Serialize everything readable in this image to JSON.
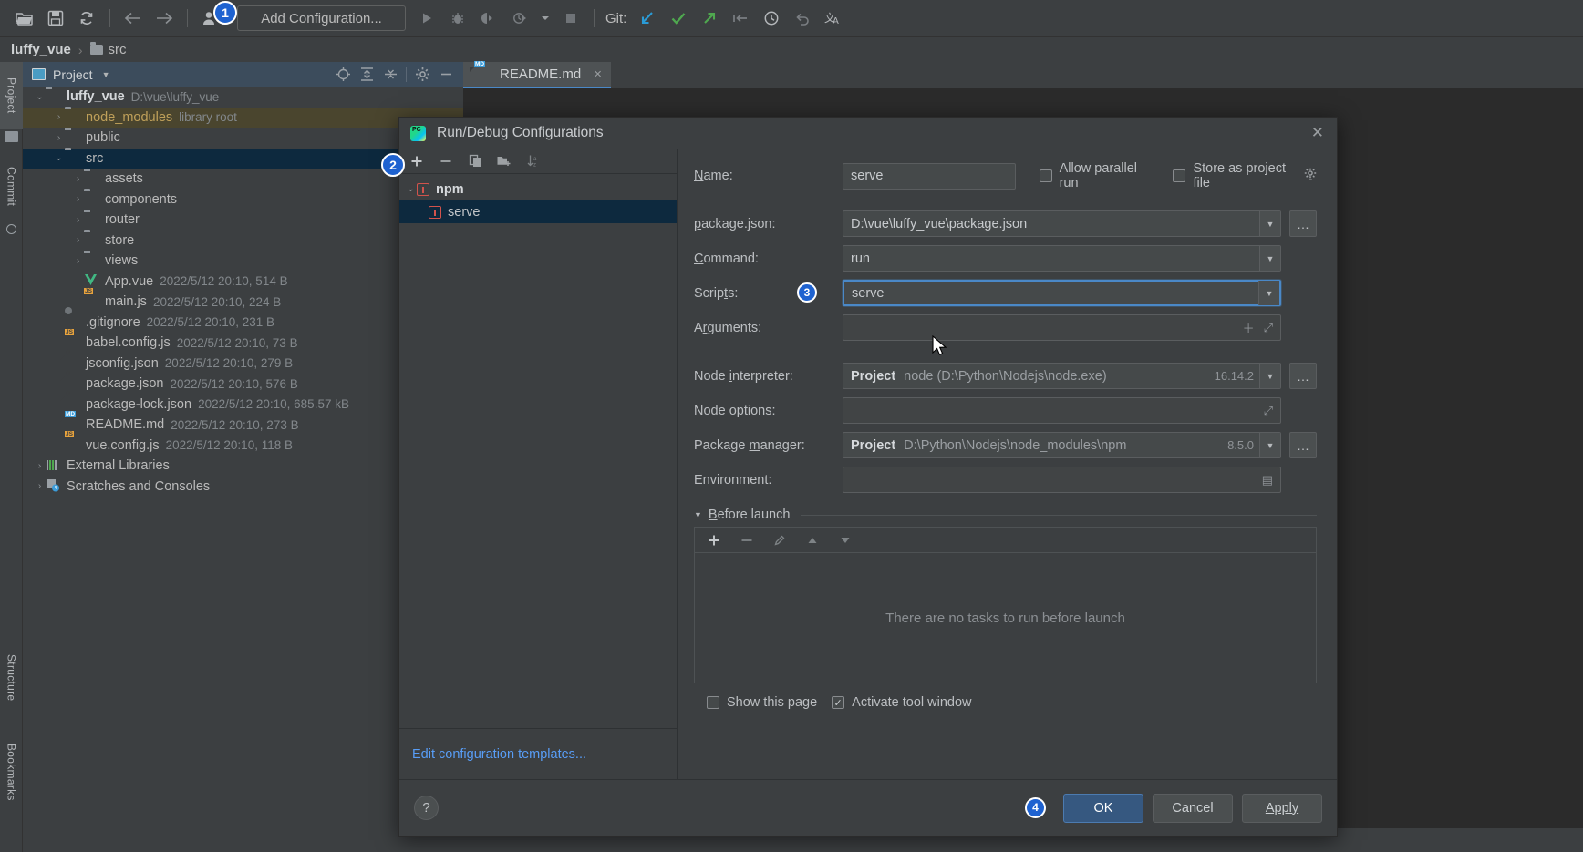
{
  "toolbar": {
    "icons": [
      "open-folder-icon",
      "save-icon",
      "sync-icon",
      "back-arrow-icon",
      "forward-arrow-icon",
      "user-profile-icon"
    ],
    "add_configuration_label": "Add Configuration...",
    "run_icons": [
      "run-icon",
      "debug-icon",
      "run-with-coverage-icon",
      "profile-icon",
      "dropdown-icon",
      "stop-icon"
    ],
    "git_label": "Git:",
    "git_icons": [
      "update-project-icon",
      "commit-icon",
      "push-icon",
      "rollback-arrow-icon",
      "history-clock-icon",
      "undo-icon",
      "translate-icon"
    ],
    "badge_1": "1"
  },
  "breadcrumb": {
    "root": "luffy_vue",
    "separator": "›",
    "current": "src"
  },
  "left_tool_bars": {
    "top": [
      {
        "label": "Project",
        "active": true
      },
      {
        "label": "Commit",
        "active": false
      }
    ],
    "bottom": [
      {
        "label": "Structure"
      },
      {
        "label": "Bookmarks"
      }
    ]
  },
  "project_panel": {
    "title": "Project",
    "toolbar_icons": [
      "locate-icon",
      "expand-all-icon",
      "collapse-all-icon",
      "gear-icon",
      "hide-icon"
    ],
    "badge_2": "2",
    "tree": [
      {
        "indent": 0,
        "arrow": "⌄",
        "icon": "folder",
        "name": "luffy_vue",
        "bold": true,
        "meta": "D:\\vue\\luffy_vue",
        "state": "normal"
      },
      {
        "indent": 1,
        "arrow": "›",
        "icon": "folder",
        "name": "node_modules",
        "bold": false,
        "meta": "library root",
        "state": "library"
      },
      {
        "indent": 1,
        "arrow": "›",
        "icon": "folder",
        "name": "public",
        "bold": false,
        "meta": "",
        "state": "normal"
      },
      {
        "indent": 1,
        "arrow": "⌄",
        "icon": "folder",
        "name": "src",
        "bold": false,
        "meta": "",
        "state": "selected"
      },
      {
        "indent": 2,
        "arrow": "›",
        "icon": "folder",
        "name": "assets",
        "bold": false,
        "meta": "",
        "state": "normal"
      },
      {
        "indent": 2,
        "arrow": "›",
        "icon": "folder",
        "name": "components",
        "bold": false,
        "meta": "",
        "state": "normal"
      },
      {
        "indent": 2,
        "arrow": "›",
        "icon": "folder",
        "name": "router",
        "bold": false,
        "meta": "",
        "state": "normal"
      },
      {
        "indent": 2,
        "arrow": "›",
        "icon": "folder",
        "name": "store",
        "bold": false,
        "meta": "",
        "state": "normal"
      },
      {
        "indent": 2,
        "arrow": "›",
        "icon": "folder",
        "name": "views",
        "bold": false,
        "meta": "",
        "state": "normal"
      },
      {
        "indent": 2,
        "arrow": "",
        "icon": "vue",
        "name": "App.vue",
        "bold": false,
        "meta": "2022/5/12 20:10, 514 B",
        "state": "normal"
      },
      {
        "indent": 2,
        "arrow": "",
        "icon": "js",
        "name": "main.js",
        "bold": false,
        "meta": "2022/5/12 20:10, 224 B",
        "state": "normal"
      },
      {
        "indent": 1,
        "arrow": "",
        "icon": "gitignore",
        "name": ".gitignore",
        "bold": false,
        "meta": "2022/5/12 20:10, 231 B",
        "state": "normal"
      },
      {
        "indent": 1,
        "arrow": "",
        "icon": "js",
        "name": "babel.config.js",
        "bold": false,
        "meta": "2022/5/12 20:10, 73 B",
        "state": "normal"
      },
      {
        "indent": 1,
        "arrow": "",
        "icon": "json",
        "name": "jsconfig.json",
        "bold": false,
        "meta": "2022/5/12 20:10, 279 B",
        "state": "normal"
      },
      {
        "indent": 1,
        "arrow": "",
        "icon": "json",
        "name": "package.json",
        "bold": false,
        "meta": "2022/5/12 20:10, 576 B",
        "state": "normal"
      },
      {
        "indent": 1,
        "arrow": "",
        "icon": "json",
        "name": "package-lock.json",
        "bold": false,
        "meta": "2022/5/12 20:10, 685.57 kB",
        "state": "normal"
      },
      {
        "indent": 1,
        "arrow": "",
        "icon": "md",
        "name": "README.md",
        "bold": false,
        "meta": "2022/5/12 20:10, 273 B",
        "state": "normal"
      },
      {
        "indent": 1,
        "arrow": "",
        "icon": "js",
        "name": "vue.config.js",
        "bold": false,
        "meta": "2022/5/12 20:10, 118 B",
        "state": "normal"
      },
      {
        "indent": 0,
        "arrow": "›",
        "icon": "library",
        "name": "External Libraries",
        "bold": false,
        "meta": "",
        "state": "normal"
      },
      {
        "indent": 0,
        "arrow": "›",
        "icon": "scratch",
        "name": "Scratches and Consoles",
        "bold": false,
        "meta": "",
        "state": "normal"
      }
    ]
  },
  "editor": {
    "tab": {
      "label": "README.md",
      "icon": "markdown-file-icon",
      "close": "×"
    }
  },
  "dialog": {
    "title": "Run/Debug Configurations",
    "icon": "pycharm-logo-icon",
    "close": "✕",
    "left_toolbar": [
      "add-icon",
      "remove-icon",
      "copy-icon",
      "new-folder-icon",
      "sort-alphabetically-icon"
    ],
    "config_tree": [
      {
        "label": "npm",
        "type": "group",
        "selected": false,
        "arrow": "⌄"
      },
      {
        "label": "serve",
        "type": "item",
        "selected": true,
        "arrow": ""
      }
    ],
    "edit_templates_link": "Edit configuration templates...",
    "fields": {
      "name_label": "Name:",
      "name_label_u": "N",
      "name_value": "serve",
      "allow_parallel_run": "Allow parallel run",
      "allow_parallel_run_checked": false,
      "store_as_project_file": "Store as project file",
      "store_as_project_file_checked": false,
      "packagejson_label": "package.json:",
      "packagejson_value": "D:\\vue\\luffy_vue\\package.json",
      "command_label": "Command:",
      "command_value": "run",
      "scripts_label": "Scripts:",
      "scripts_value": "serve",
      "scripts_badge": "3",
      "arguments_label": "Arguments:",
      "arguments_value": "",
      "node_interpreter_label": "Node interpreter:",
      "node_interpreter_prefix": "Project",
      "node_interpreter_value": "node (D:\\Python\\Nodejs\\node.exe)",
      "node_interpreter_version": "16.14.2",
      "node_options_label": "Node options:",
      "node_options_value": "",
      "package_manager_label": "Package manager:",
      "package_manager_prefix": "Project",
      "package_manager_value": "D:\\Python\\Nodejs\\node_modules\\npm",
      "package_manager_version": "8.5.0",
      "environment_label": "Environment:",
      "environment_value": ""
    },
    "before_launch": {
      "title": "Before launch",
      "tools": [
        "add-icon",
        "remove-icon",
        "edit-icon",
        "move-up-icon",
        "move-down-icon"
      ],
      "empty_text": "There are no tasks to run before launch"
    },
    "checkboxes": {
      "show_this_page": "Show this page",
      "show_this_page_checked": false,
      "activate_tool_window": "Activate tool window",
      "activate_tool_window_checked": true
    },
    "footer": {
      "help": "?",
      "ok": "OK",
      "cancel": "Cancel",
      "apply": "Apply",
      "badge_4": "4"
    }
  },
  "colors": {
    "accent_blue": "#4a88c7",
    "primary_button": "#365880",
    "badge_blue": "#1e62d0",
    "selection": "#0d293e",
    "library_row": "#4a452e",
    "panel_bg": "#3c3f41",
    "editor_bg": "#2b2b2b",
    "link": "#589df6"
  }
}
